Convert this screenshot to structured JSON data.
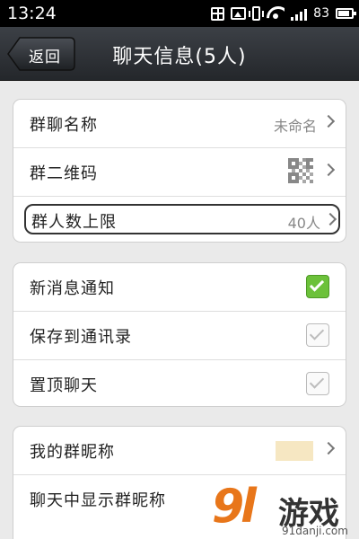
{
  "status_bar": {
    "time": "13:24",
    "battery_text": "83",
    "icons": [
      "grid-icon",
      "image-icon",
      "vibrate-icon",
      "wifi-icon",
      "signal-icon",
      "battery-icon"
    ]
  },
  "nav": {
    "back_label": "返回",
    "title": "聊天信息(5人)"
  },
  "group1": {
    "rows": [
      {
        "label": "群聊名称",
        "value": "未命名"
      },
      {
        "label": "群二维码",
        "value": ""
      },
      {
        "label": "群人数上限",
        "value": "40人"
      }
    ]
  },
  "group2": {
    "rows": [
      {
        "label": "新消息通知",
        "checked": true
      },
      {
        "label": "保存到通讯录",
        "checked": false
      },
      {
        "label": "置顶聊天",
        "checked": false
      }
    ]
  },
  "group3": {
    "rows": [
      {
        "label": "我的群昵称",
        "value": ""
      },
      {
        "label": "聊天中显示群昵称"
      }
    ]
  },
  "watermark": {
    "number": "9l",
    "text": "游戏",
    "url": "91danji.com"
  },
  "colors": {
    "navbar": "#2f3237",
    "check_on": "#6cc13a",
    "watermark_orange": "#e8761a",
    "nickname_box": "#f6e7c2"
  }
}
